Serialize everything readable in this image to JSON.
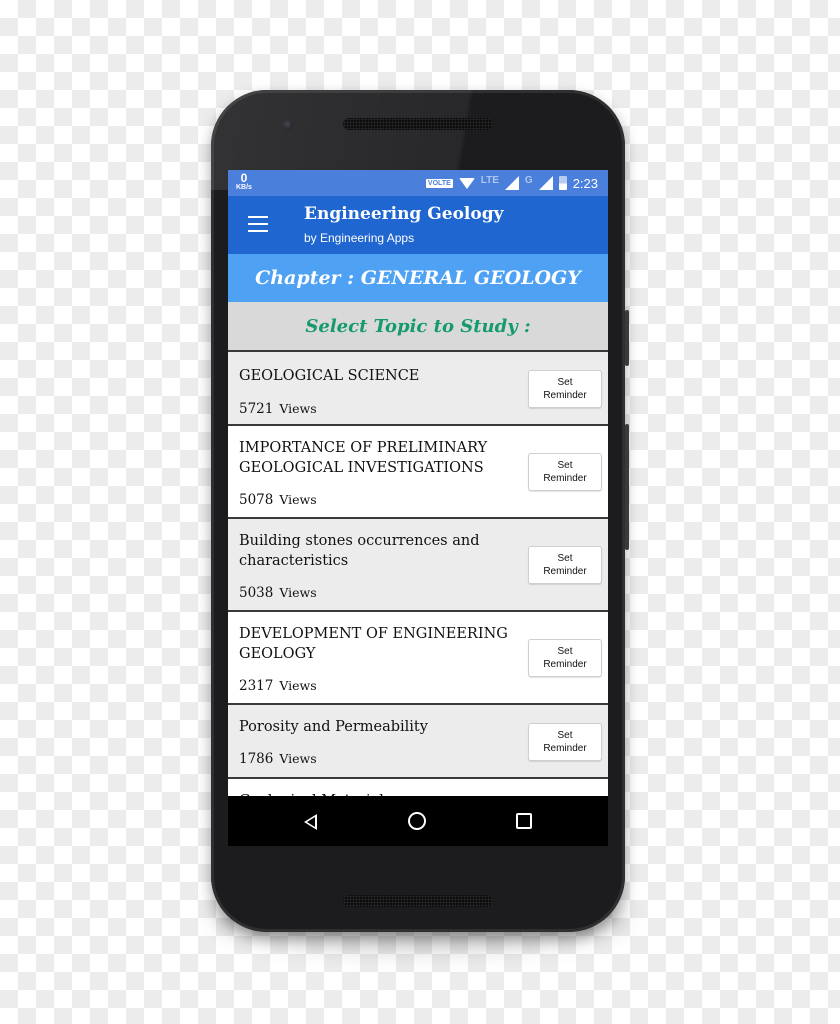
{
  "status_bar": {
    "data_rate_value": "0",
    "data_rate_unit": "KB/s",
    "volte_label": "VOLTE",
    "network_1": "LTE",
    "network_2": "G",
    "time": "2:23"
  },
  "app_bar": {
    "title": "Engineering Geology",
    "subtitle": "by Engineering Apps",
    "menu_icon": "hamburger-menu-icon"
  },
  "chapter": {
    "label": "Chapter : GENERAL GEOLOGY"
  },
  "select_topic": {
    "label": "Select Topic to Study :"
  },
  "topics": [
    {
      "title": " GEOLOGICAL SCIENCE",
      "views": "5721",
      "views_label": "Views",
      "button": "Set Reminder"
    },
    {
      "title": "IMPORTANCE OF PRELIMINARY GEOLOGICAL INVESTIGATIONS",
      "views": "5078",
      "views_label": "Views",
      "button": "Set Reminder"
    },
    {
      "title": "Building stones  occurrences and characteristics",
      "views": "5038",
      "views_label": "Views",
      "button": "Set Reminder"
    },
    {
      "title": "DEVELOPMENT OF ENGINEERING GEOLOGY",
      "views": "2317",
      "views_label": "Views",
      "button": "Set Reminder"
    },
    {
      "title": "Porosity and Permeability",
      "views": "1786",
      "views_label": "Views",
      "button": "Set Reminder"
    },
    {
      "title": "Geological Materials"
    }
  ],
  "nav_bar": {
    "back": "back-icon",
    "home": "home-icon",
    "recents": "recents-icon"
  },
  "colors": {
    "status_bar": "#4a7fdc",
    "app_bar": "#1f66d0",
    "chapter_bar": "#4ea1f3",
    "select_topic_text": "#149a6e",
    "select_topic_bg": "#d9d9d9"
  }
}
